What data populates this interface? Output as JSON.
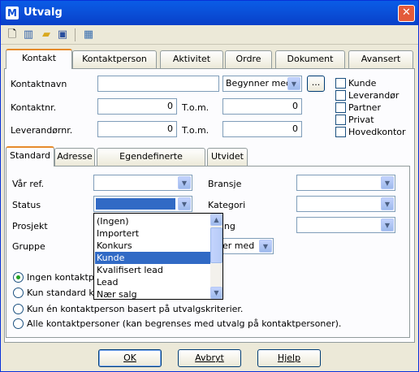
{
  "window": {
    "title": "Utvalg",
    "app_icon_text": "M"
  },
  "toolbar": {
    "icons": [
      "new-document-icon",
      "book-icon",
      "open-folder-icon",
      "save-icon",
      "table-icon"
    ]
  },
  "main_tabs": [
    "Kontakt",
    "Kontaktperson",
    "Aktivitet",
    "Ordre",
    "Dokument",
    "Avansert"
  ],
  "contact": {
    "name_label": "Kontaktnavn",
    "name_value": "",
    "match_mode": "Begynner med",
    "browse_label": "...",
    "number_label": "Kontaktnr.",
    "number_from": "0",
    "number_to": "0",
    "to_label": "T.o.m.",
    "supplier_label": "Leverandørnr.",
    "supplier_from": "0",
    "supplier_to": "0",
    "checkboxes": [
      "Kunde",
      "Leverandør",
      "Partner",
      "Privat",
      "Hovedkontor"
    ]
  },
  "sub_tabs": [
    "Standard",
    "Adresse",
    "Egendefinerte felter/Notat",
    "Utvidet"
  ],
  "standard": {
    "our_ref_label": "Vår ref.",
    "status_label": "Status",
    "project_label": "Prosjekt",
    "group_label": "Gruppe",
    "industry_label": "Bransje",
    "category_label": "Kategori",
    "division_label_partial": "eling",
    "group_match_partial": "ner med"
  },
  "status_dropdown": {
    "options": [
      "(Ingen)",
      "Importert",
      "Konkurs",
      "Kunde",
      "Kvalifisert lead",
      "Lead",
      "Nær salg"
    ],
    "selected": "Kunde"
  },
  "radio_options": [
    "Ingen kontaktpers",
    "Kun standard kon",
    "Kun én kontaktperson basert på utvalgskriterier.",
    "Alle kontaktpersoner (kan begrenses med utvalg på kontaktpersoner)."
  ],
  "buttons": {
    "ok": "OK",
    "cancel": "Avbryt",
    "help": "Hjelp"
  },
  "colors": {
    "title_bar": "#0a4fd8",
    "selection": "#316ac5",
    "tab_highlight": "#e68b2c",
    "window_bg": "#ece9d8"
  }
}
